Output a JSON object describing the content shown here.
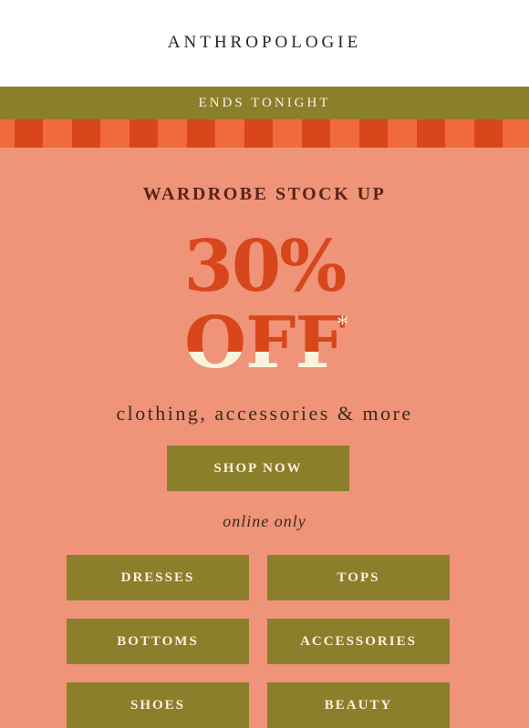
{
  "header": {
    "logo": "ANTHROPOLOGIE"
  },
  "banner": {
    "text": "ENDS TONIGHT"
  },
  "promo": {
    "headline": "WARDROBE STOCK UP",
    "percent": "30%",
    "off": "OFF",
    "asterisk": "*",
    "subtitle": "clothing, accessories & more",
    "cta": "SHOP NOW",
    "note": "online only"
  },
  "categories": [
    {
      "label": "DRESSES"
    },
    {
      "label": "TOPS"
    },
    {
      "label": "BOTTOMS"
    },
    {
      "label": "ACCESSORIES"
    },
    {
      "label": "SHOES"
    },
    {
      "label": "BEAUTY"
    }
  ],
  "colors": {
    "olive": "#8b7f2c",
    "salmon": "#ef9478",
    "orange": "#d8461b",
    "cream": "#fbf4dc"
  }
}
